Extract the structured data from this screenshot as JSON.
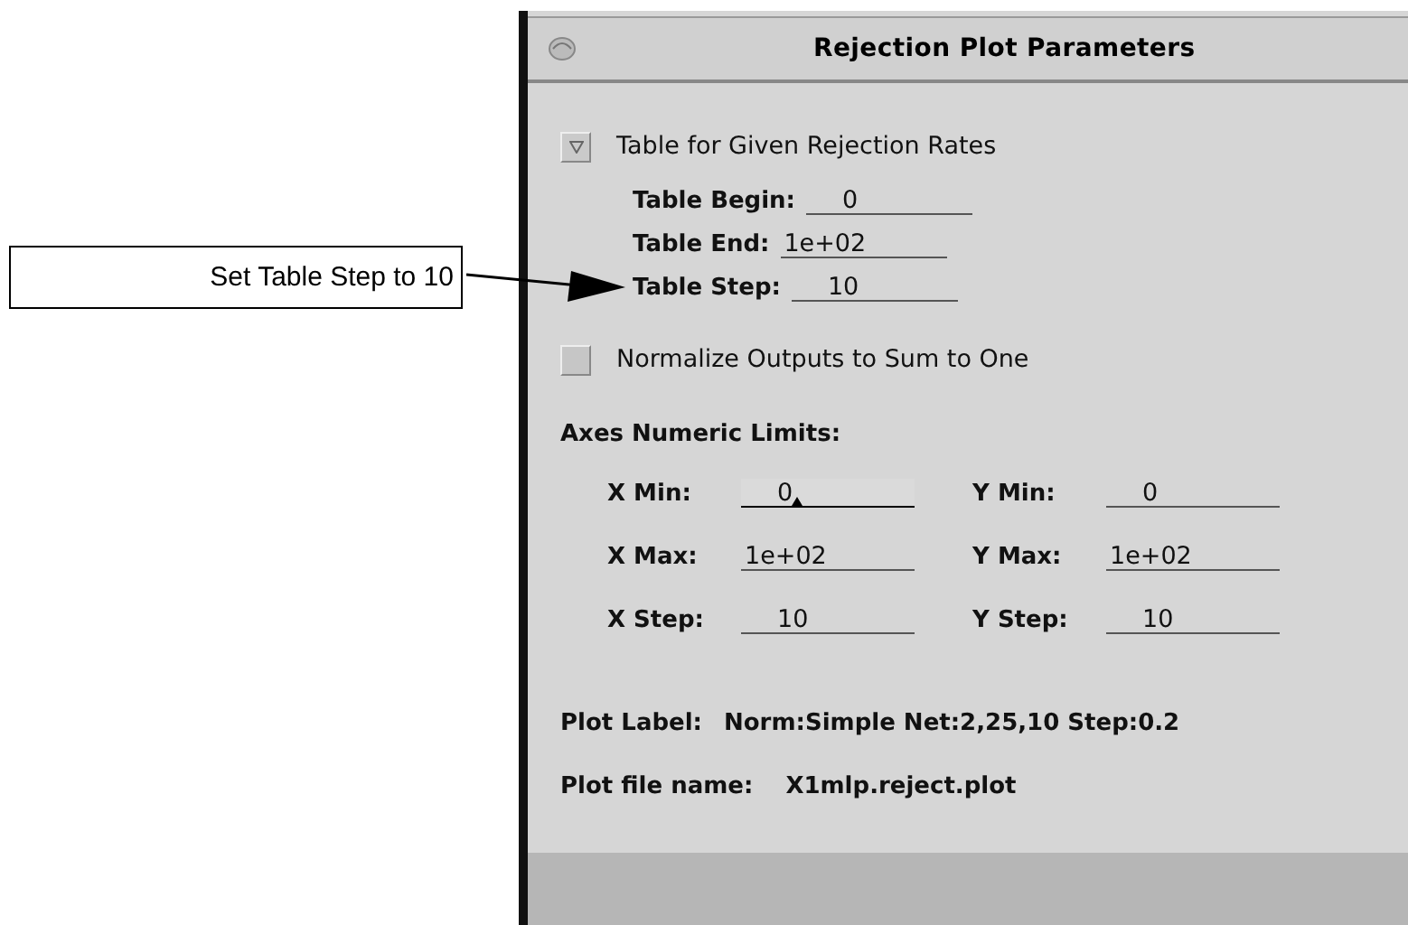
{
  "callout": {
    "text": "Set Table Step to 10"
  },
  "window": {
    "title": "Rejection Plot Parameters"
  },
  "table_option": {
    "label": "Table for Given Rejection Rates",
    "checked": true
  },
  "table_fields": [
    {
      "label": "Table Begin:",
      "value": "0"
    },
    {
      "label": "Table End:",
      "value": "1e+02"
    },
    {
      "label": "Table Step:",
      "value": "10"
    }
  ],
  "normalize_option": {
    "label": "Normalize Outputs to Sum to One",
    "checked": false
  },
  "axes": {
    "heading": "Axes Numeric Limits:",
    "rows": [
      [
        {
          "label": "X Min:",
          "value": "0",
          "focused": true
        },
        {
          "label": "Y Min:",
          "value": "0",
          "focused": false
        }
      ],
      [
        {
          "label": "X Max:",
          "value": "1e+02",
          "focused": false
        },
        {
          "label": "Y Max:",
          "value": "1e+02",
          "focused": false
        }
      ],
      [
        {
          "label": "X Step:",
          "value": "10",
          "focused": false
        },
        {
          "label": "Y Step:",
          "value": "10",
          "focused": false
        }
      ]
    ]
  },
  "plot_label": {
    "label": "Plot Label:",
    "value": "Norm:Simple Net:2,25,10 Step:0.2"
  },
  "plot_file": {
    "label": "Plot file name:",
    "value": "X1mlp.reject.plot"
  }
}
